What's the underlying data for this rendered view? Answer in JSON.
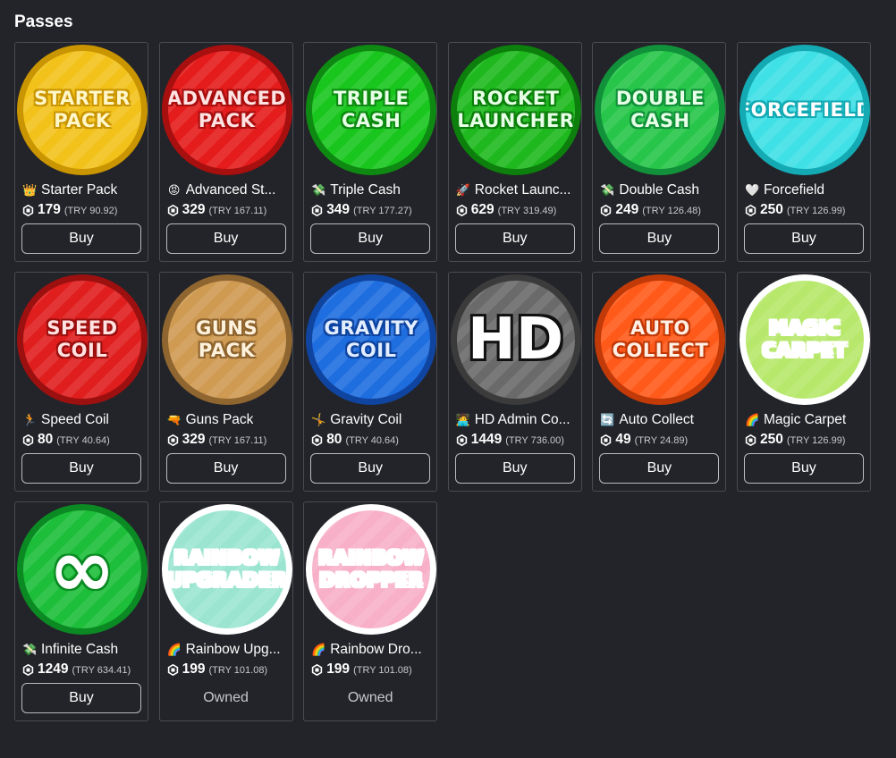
{
  "section_title": "Passes",
  "passes": [
    {
      "thumb_text": "STARTER\nPACK",
      "thumb_bg": "#f2c21b",
      "thumb_ring": "#c99500",
      "thumb_text_color": "#fff7c9",
      "emoji": "👑",
      "emoji_icon": "crown-icon",
      "name": "Starter Pack",
      "price": "179",
      "try_price": "(TRY 90.92)",
      "action": "Buy"
    },
    {
      "thumb_text": "ADVANCED\nPACK",
      "thumb_bg": "#e51c1c",
      "thumb_ring": "#a80f0f",
      "thumb_text_color": "#ffe2e2",
      "emoji": "😡",
      "emoji_icon": "angry-face-icon",
      "name": "Advanced St...",
      "price": "329",
      "try_price": "(TRY 167.11)",
      "action": "Buy"
    },
    {
      "thumb_text": "TRIPLE\nCASH",
      "thumb_bg": "#19c61e",
      "thumb_ring": "#0e8a12",
      "thumb_text_color": "#e6ffe6",
      "emoji": "💸",
      "emoji_icon": "money-icon",
      "name": "Triple Cash",
      "price": "349",
      "try_price": "(TRY 177.27)",
      "action": "Buy"
    },
    {
      "thumb_text": "ROCKET\nLAUNCHER",
      "thumb_bg": "#1fb91f",
      "thumb_ring": "#0c7f0c",
      "thumb_text_color": "#e6ffe6",
      "emoji": "🚀",
      "emoji_icon": "rocket-icon",
      "name": "Rocket Launc...",
      "price": "629",
      "try_price": "(TRY 319.49)",
      "action": "Buy"
    },
    {
      "thumb_text": "DOUBLE\nCASH",
      "thumb_bg": "#27c64a",
      "thumb_ring": "#11913a",
      "thumb_text_color": "#e6ffe6",
      "emoji": "💸",
      "emoji_icon": "money-icon",
      "name": "Double Cash",
      "price": "249",
      "try_price": "(TRY 126.48)",
      "action": "Buy"
    },
    {
      "thumb_text": "FORCEFIELD",
      "thumb_bg": "#3fe0e6",
      "thumb_ring": "#14aab4",
      "thumb_text_color": "#ffffff",
      "emoji": "🤍",
      "emoji_icon": "white-heart-icon",
      "name": "Forcefield",
      "price": "250",
      "try_price": "(TRY 126.99)",
      "action": "Buy"
    },
    {
      "thumb_text": "SPEED\nCOIL",
      "thumb_bg": "#e01e1e",
      "thumb_ring": "#9c1010",
      "thumb_text_color": "#ffe2e2",
      "emoji": "🏃",
      "emoji_icon": "runner-icon",
      "name": "Speed Coil",
      "price": "80",
      "try_price": "(TRY 40.64)",
      "action": "Buy"
    },
    {
      "thumb_text": "GUNS\nPACK",
      "thumb_bg": "#cf9a52",
      "thumb_ring": "#8f6530",
      "thumb_text_color": "#fff2dc",
      "emoji": "🔫",
      "emoji_icon": "gun-icon",
      "name": "Guns Pack",
      "price": "329",
      "try_price": "(TRY 167.11)",
      "action": "Buy"
    },
    {
      "thumb_text": "GRAVITY\nCOIL",
      "thumb_bg": "#1f6ee0",
      "thumb_ring": "#0f45a0",
      "thumb_text_color": "#e2eeff",
      "emoji": "🤸",
      "emoji_icon": "cartwheel-icon",
      "name": "Gravity Coil",
      "price": "80",
      "try_price": "(TRY 40.64)",
      "action": "Buy"
    },
    {
      "thumb_text": "HD",
      "thumb_bg": "#6a6a6a",
      "thumb_ring": "#3b3b3b",
      "thumb_text_color": "#ffffff",
      "emoji": "🧑‍💻",
      "emoji_icon": "technologist-icon",
      "name": "HD Admin Co...",
      "price": "1449",
      "try_price": "(TRY 736.00)",
      "action": "Buy"
    },
    {
      "thumb_text": "AUTO\nCOLLECT",
      "thumb_bg": "#ff5a1a",
      "thumb_ring": "#c23a08",
      "thumb_text_color": "#fff0e6",
      "emoji": "🔄",
      "emoji_icon": "cycle-arrows-icon",
      "name": "Auto Collect",
      "price": "49",
      "try_price": "(TRY 24.89)",
      "action": "Buy"
    },
    {
      "thumb_text": "MAGIC\nCARPET",
      "thumb_bg": "#b7e86b",
      "thumb_ring": "#ffffff",
      "thumb_text_color": "#ffffff",
      "emoji": "🌈",
      "emoji_icon": "rainbow-icon",
      "name": "Magic Carpet",
      "price": "250",
      "try_price": "(TRY 126.99)",
      "action": "Buy"
    },
    {
      "thumb_text": "∞",
      "thumb_bg": "#1cbe3a",
      "thumb_ring": "#0b8a23",
      "thumb_text_color": "#ffffff",
      "emoji": "💸",
      "emoji_icon": "money-icon",
      "name": "Infinite Cash",
      "price": "1249",
      "try_price": "(TRY 634.41)",
      "action": "Buy"
    },
    {
      "thumb_text": "RAINBOW\nUPGRADER",
      "thumb_bg": "#9be5d0",
      "thumb_ring": "#ffffff",
      "thumb_text_color": "#ffffff",
      "emoji": "🌈",
      "emoji_icon": "rainbow-icon",
      "name": "Rainbow Upg...",
      "price": "199",
      "try_price": "(TRY 101.08)",
      "action": "Owned"
    },
    {
      "thumb_text": "RAINBOW\nDROPPER",
      "thumb_bg": "#f7b0c8",
      "thumb_ring": "#ffffff",
      "thumb_text_color": "#ffffff",
      "emoji": "🌈",
      "emoji_icon": "rainbow-icon",
      "name": "Rainbow Dro...",
      "price": "199",
      "try_price": "(TRY 101.08)",
      "action": "Owned"
    }
  ]
}
